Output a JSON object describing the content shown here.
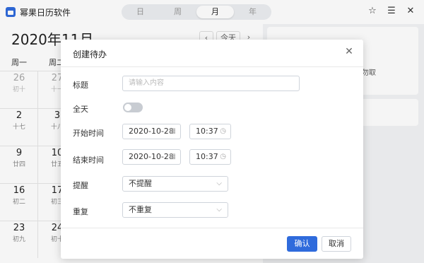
{
  "app": {
    "title": "幂果日历软件"
  },
  "view_tabs": [
    {
      "label": "日"
    },
    {
      "label": "周"
    },
    {
      "label": "月"
    },
    {
      "label": "年"
    }
  ],
  "titlebar_icons": {
    "star": "☆",
    "list": "☰",
    "close": "✕"
  },
  "calendar": {
    "month_title": "2020年11月",
    "prev": "‹",
    "today": "今天",
    "next": "›",
    "weekdays": [
      "周一",
      "周二"
    ],
    "cells": [
      [
        {
          "g": "26",
          "l": "初十",
          "dim": true
        },
        {
          "g": "27",
          "l": "十一",
          "dim": true
        }
      ],
      [
        {
          "g": "2",
          "l": "十七"
        },
        {
          "g": "3",
          "l": "十八"
        }
      ],
      [
        {
          "g": "9",
          "l": "廿四"
        },
        {
          "g": "10",
          "l": "廿五"
        }
      ],
      [
        {
          "g": "16",
          "l": "初二"
        },
        {
          "g": "17",
          "l": "初三"
        }
      ],
      [
        {
          "g": "23",
          "l": "初九"
        },
        {
          "g": "24",
          "l": "初十"
        }
      ]
    ]
  },
  "right_panel": {
    "text_fragment": "勿取"
  },
  "dialog": {
    "title": "创建待办",
    "close": "✕",
    "fields": {
      "title_label": "标题",
      "title_placeholder": "请输入内容",
      "allday_label": "全天",
      "start_label": "开始时间",
      "start_date": "2020-10-28",
      "start_time": "10:37",
      "end_label": "结束时间",
      "end_date": "2020-10-28",
      "end_time": "10:37",
      "remind_label": "提醒",
      "remind_value": "不提醒",
      "repeat_label": "重复",
      "repeat_value": "不重复"
    },
    "confirm": "确认",
    "cancel": "取消"
  },
  "colors": {
    "primary": "#2f6bdc",
    "toggle_off": "#c8ccd2"
  }
}
